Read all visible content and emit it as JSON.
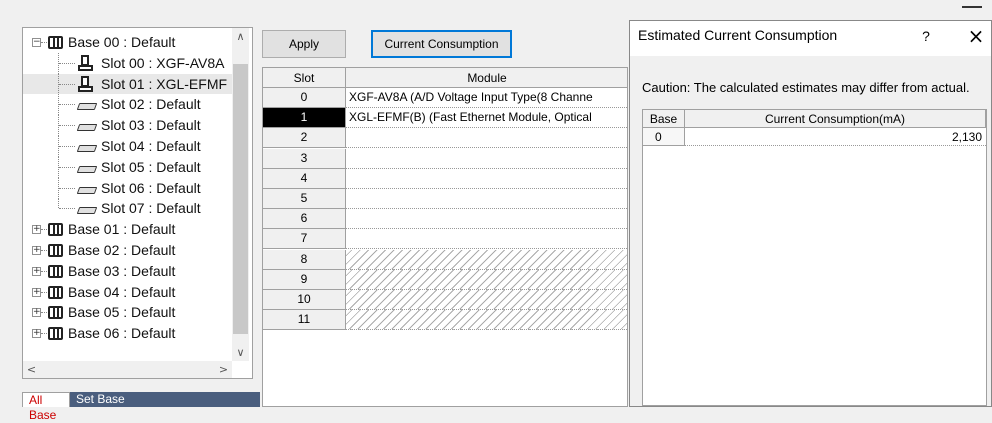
{
  "tree": {
    "items": [
      {
        "label": "Base 00 : Default",
        "kind": "base",
        "expander": "−"
      },
      {
        "label": "Slot 00 : XGF-AV8A",
        "kind": "module"
      },
      {
        "label": "Slot 01 : XGL-EFMF",
        "kind": "module"
      },
      {
        "label": "Slot 02 : Default",
        "kind": "slot"
      },
      {
        "label": "Slot 03 : Default",
        "kind": "slot"
      },
      {
        "label": "Slot 04 : Default",
        "kind": "slot"
      },
      {
        "label": "Slot 05 : Default",
        "kind": "slot"
      },
      {
        "label": "Slot 06 : Default",
        "kind": "slot"
      },
      {
        "label": "Slot 07 : Default",
        "kind": "slot"
      },
      {
        "label": "Base 01 : Default",
        "kind": "base",
        "expander": "+"
      },
      {
        "label": "Base 02 : Default",
        "kind": "base",
        "expander": "+"
      },
      {
        "label": "Base 03 : Default",
        "kind": "base",
        "expander": "+"
      },
      {
        "label": "Base 04 : Default",
        "kind": "base",
        "expander": "+"
      },
      {
        "label": "Base 05 : Default",
        "kind": "base",
        "expander": "+"
      },
      {
        "label": "Base 06 : Default",
        "kind": "base",
        "expander": "+"
      }
    ],
    "scroll_up": "∧",
    "scroll_down": "∨",
    "scroll_left": "<",
    "scroll_right": ">"
  },
  "tabs": {
    "all_base": "All Base",
    "set_base": "Set Base"
  },
  "toolbar": {
    "apply_label": "Apply",
    "current_consumption_label": "Current Consumption"
  },
  "grid": {
    "col_slot": "Slot",
    "col_module": "Module",
    "rows": [
      {
        "slot": "0",
        "module": "XGF-AV8A (A/D Voltage Input Type(8 Channe",
        "hatched": false
      },
      {
        "slot": "1",
        "module": "XGL-EFMF(B) (Fast Ethernet Module, Optical",
        "hatched": false
      },
      {
        "slot": "2",
        "module": "",
        "hatched": false
      },
      {
        "slot": "3",
        "module": "",
        "hatched": false
      },
      {
        "slot": "4",
        "module": "",
        "hatched": false
      },
      {
        "slot": "5",
        "module": "",
        "hatched": false
      },
      {
        "slot": "6",
        "module": "",
        "hatched": false
      },
      {
        "slot": "7",
        "module": "",
        "hatched": false
      },
      {
        "slot": "8",
        "module": "",
        "hatched": true
      },
      {
        "slot": "9",
        "module": "",
        "hatched": true
      },
      {
        "slot": "10",
        "module": "",
        "hatched": true
      },
      {
        "slot": "11",
        "module": "",
        "hatched": true
      }
    ]
  },
  "dialog": {
    "title": "Estimated Current Consumption",
    "help": "?",
    "close": "×",
    "caution": "Caution: The calculated estimates may differ from actual.",
    "col_base": "Base",
    "col_current": "Current Consumption(mA)",
    "rows": [
      {
        "base": "0",
        "current": "2,130"
      }
    ]
  },
  "colors": {
    "accent": "#0078d7",
    "tab_active_text": "#cc0000",
    "tab_bar": "#4a5e7e"
  }
}
